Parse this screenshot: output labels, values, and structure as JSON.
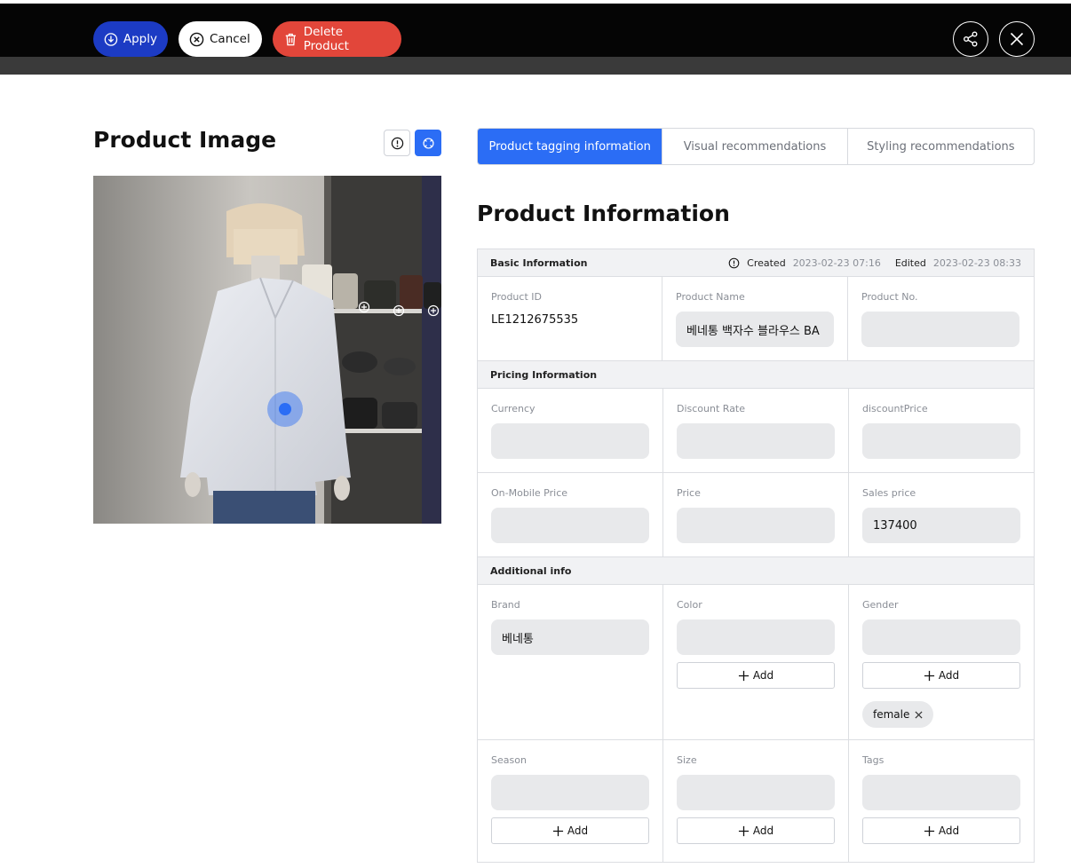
{
  "toolbar": {
    "apply_label": "Apply",
    "cancel_label": "Cancel",
    "delete_label": "Delete Product"
  },
  "left": {
    "title": "Product Image"
  },
  "tabs": [
    {
      "label": "Product tagging information",
      "active": true
    },
    {
      "label": "Visual recommendations",
      "active": false
    },
    {
      "label": "Styling recommendations",
      "active": false
    }
  ],
  "main": {
    "title": "Product Information"
  },
  "basic": {
    "section_label": "Basic Information",
    "created_label": "Created",
    "created_value": "2023-02-23 07:16",
    "edited_label": "Edited",
    "edited_value": "2023-02-23 08:33",
    "product_id_label": "Product ID",
    "product_id_value": "LE1212675535",
    "product_name_label": "Product Name",
    "product_name_value": "베네통 백자수 블라우스 BA",
    "product_no_label": "Product No.",
    "product_no_value": ""
  },
  "pricing": {
    "section_label": "Pricing Information",
    "currency_label": "Currency",
    "currency_value": "",
    "discount_rate_label": "Discount Rate",
    "discount_rate_value": "",
    "discount_price_label": "discountPrice",
    "discount_price_value": "",
    "mobile_price_label": "On-Mobile Price",
    "mobile_price_value": "",
    "price_label": "Price",
    "price_value": "",
    "sales_price_label": "Sales price",
    "sales_price_value": "137400"
  },
  "additional": {
    "section_label": "Additional info",
    "brand_label": "Brand",
    "brand_value": "베네통",
    "color_label": "Color",
    "color_value": "",
    "gender_label": "Gender",
    "gender_value": "",
    "gender_tag": "female",
    "season_label": "Season",
    "season_value": "",
    "size_label": "Size",
    "size_value": "",
    "tags_label": "Tags",
    "tags_value": "",
    "add_label": "Add"
  },
  "colors": {
    "apply": "#1c3bc4",
    "delete": "#e2463a",
    "accent": "#2b6df5"
  }
}
